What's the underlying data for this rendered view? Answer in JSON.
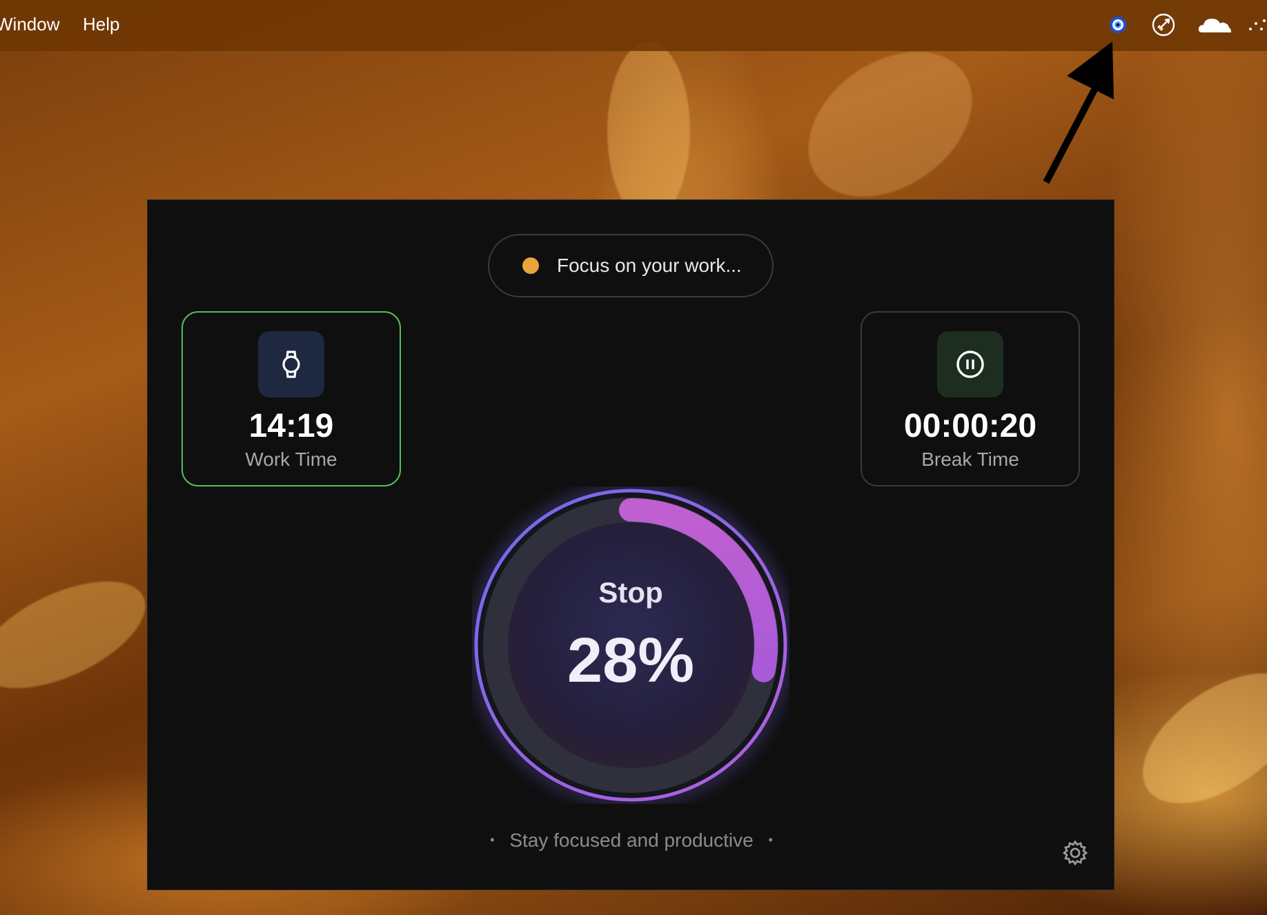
{
  "menubar": {
    "items": [
      "Window",
      "Help"
    ]
  },
  "tray_icons": [
    "eye-app-icon",
    "rocket-icon",
    "cloud-icon",
    "grip-icon"
  ],
  "panel": {
    "status": {
      "text": "Focus on your work...",
      "dot_color": "#e8a33c"
    },
    "work_card": {
      "time": "14:19",
      "label": "Work Time",
      "icon": "watch-icon",
      "accent": "#4fc15b"
    },
    "break_card": {
      "time": "00:00:20",
      "label": "Break Time",
      "icon": "pause-icon"
    },
    "progress": {
      "action_label": "Stop",
      "percent_text": "28%",
      "value": 0.28
    },
    "footer": "Stay focused and productive",
    "settings_icon": "gear-icon"
  }
}
